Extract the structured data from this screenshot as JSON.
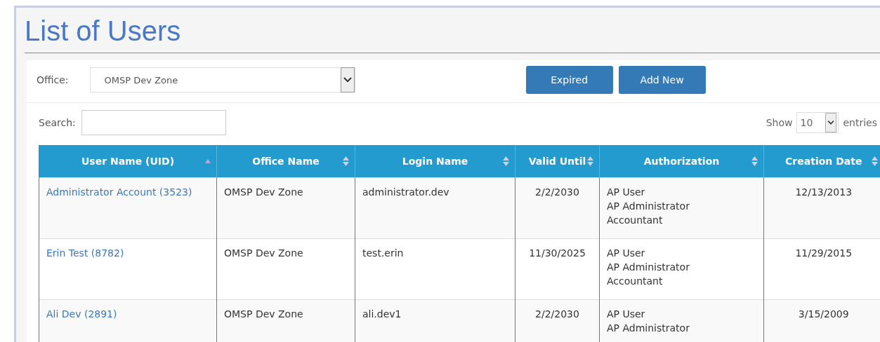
{
  "title": "List of Users",
  "office_filter": {
    "label": "Office:",
    "value": "OMSP Dev Zone"
  },
  "buttons": [
    "Expired",
    "Add New"
  ],
  "search": {
    "label": "Search:"
  },
  "page_length": {
    "before": "Show",
    "value": "10",
    "after": "entries"
  },
  "table": {
    "columns": [
      {
        "label": "User Name (UID)",
        "sorted": true
      },
      {
        "label": "Office Name",
        "sorted": false
      },
      {
        "label": "Login Name",
        "sorted": false
      },
      {
        "label": "Valid Until",
        "sorted": false
      },
      {
        "label": "Authorization",
        "sorted": false
      },
      {
        "label": "Creation Date",
        "sorted": false
      }
    ],
    "rows": [
      {
        "user": "Administrator Account (3523)",
        "office": "OMSP Dev Zone",
        "login": "administrator.dev",
        "valid_until": "2/2/2030",
        "authorization": [
          "AP User",
          "AP Administrator",
          "Accountant"
        ],
        "created": "12/13/2013"
      },
      {
        "user": "Erin Test (8782)",
        "office": "OMSP Dev Zone",
        "login": "test.erin",
        "valid_until": "11/30/2025",
        "authorization": [
          "AP User",
          "AP Administrator",
          "Accountant"
        ],
        "created": "11/29/2015"
      },
      {
        "user": "Ali Dev (2891)",
        "office": "OMSP Dev Zone",
        "login": "ali.dev1",
        "valid_until": "2/2/2030",
        "authorization": [
          "AP User",
          "AP Administrator"
        ],
        "created": "3/15/2009"
      }
    ]
  }
}
